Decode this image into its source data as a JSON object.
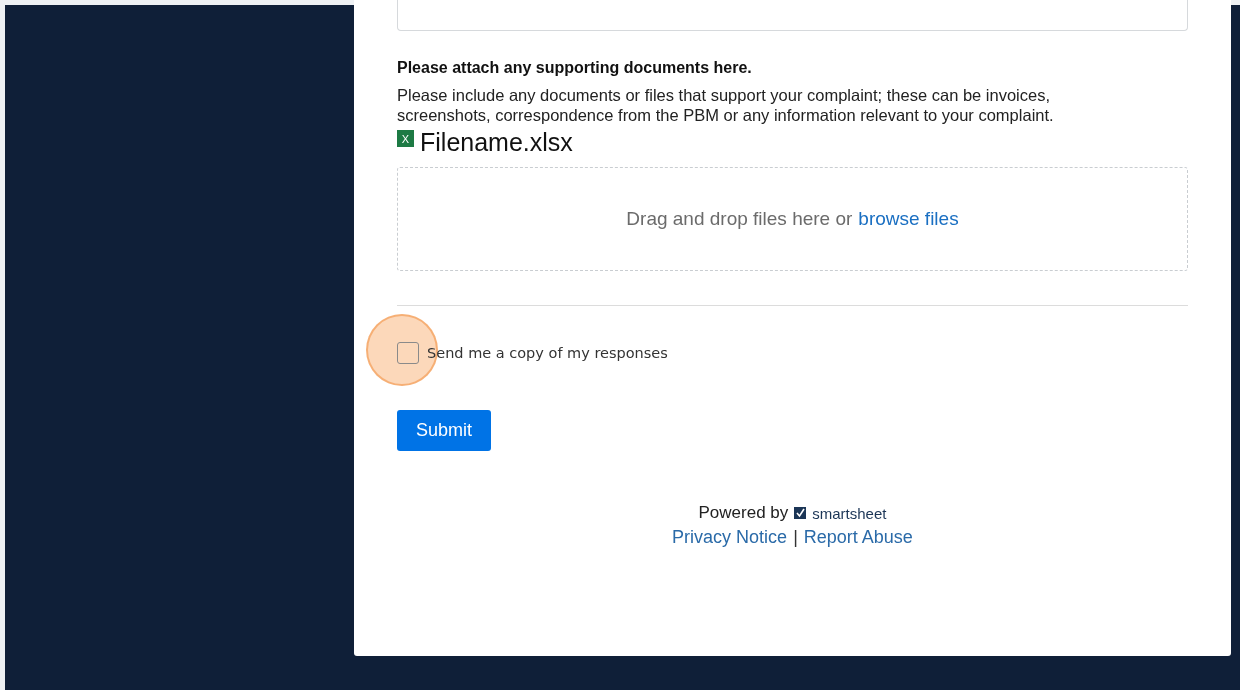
{
  "attachments": {
    "heading": "Please attach any supporting documents here.",
    "description": "Please include any documents or files that support your complaint; these can be invoices, screenshots, correspondence from the PBM or any information relevant to your complaint.",
    "files": [
      {
        "icon": "X",
        "name": "Filename.xlsx"
      }
    ],
    "dropzone": {
      "text": "Drag and drop files here or",
      "link": "browse files"
    }
  },
  "copy_option": {
    "label": "Send me a copy of my responses",
    "checked": false,
    "highlighted": true
  },
  "submit": "Submit",
  "footer": {
    "powered_by": "Powered by",
    "brand": "smartsheet",
    "links": [
      {
        "label": "Privacy Notice"
      },
      {
        "label": "Report Abuse"
      }
    ],
    "separator": "|"
  }
}
